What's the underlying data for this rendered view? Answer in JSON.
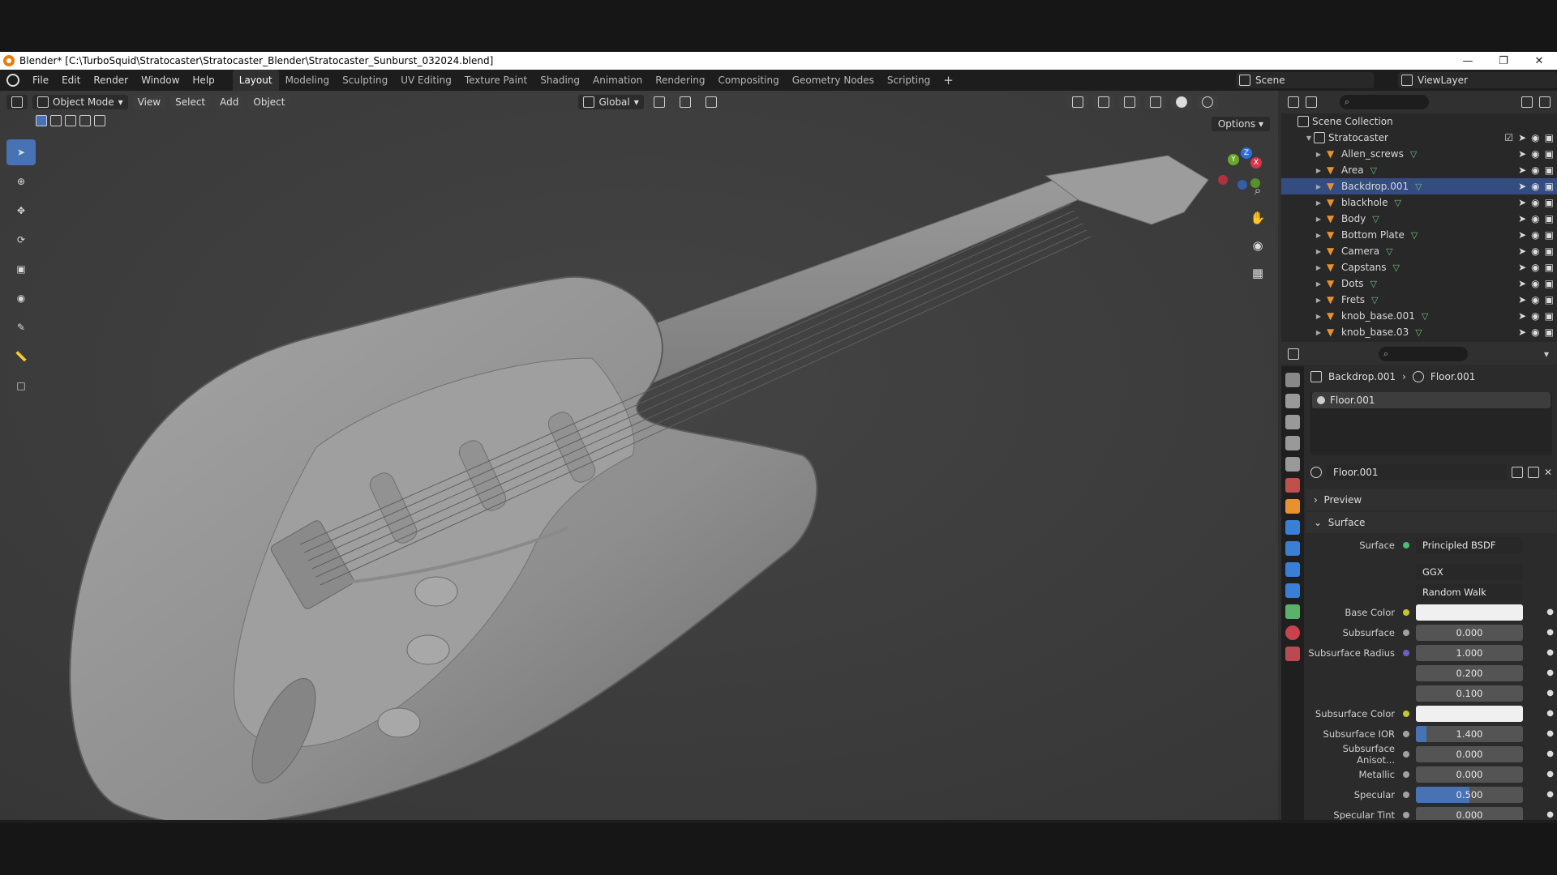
{
  "window": {
    "title": "Blender* [C:\\TurboSquid\\Stratocaster\\Stratocaster_Blender\\Stratocaster_Sunburst_032024.blend]"
  },
  "menu": {
    "items": [
      "File",
      "Edit",
      "Render",
      "Window",
      "Help"
    ]
  },
  "workspaces": {
    "tabs": [
      "Layout",
      "Modeling",
      "Sculpting",
      "UV Editing",
      "Texture Paint",
      "Shading",
      "Animation",
      "Rendering",
      "Compositing",
      "Geometry Nodes",
      "Scripting"
    ],
    "active": "Layout"
  },
  "scene": {
    "name": "Scene",
    "view_layer": "ViewLayer"
  },
  "viewport": {
    "mode": "Object Mode",
    "menus": [
      "View",
      "Select",
      "Add",
      "Object"
    ],
    "orientation": "Global",
    "options_label": "Options",
    "gizmo": {
      "x": "X",
      "y": "Y",
      "z": "Z"
    }
  },
  "outliner": {
    "collection": "Scene Collection",
    "root": "Stratocaster",
    "items": [
      {
        "name": "Allen_screws"
      },
      {
        "name": "Area"
      },
      {
        "name": "Backdrop.001"
      },
      {
        "name": "blackhole"
      },
      {
        "name": "Body"
      },
      {
        "name": "Bottom Plate"
      },
      {
        "name": "Camera"
      },
      {
        "name": "Capstans"
      },
      {
        "name": "Dots"
      },
      {
        "name": "Frets"
      },
      {
        "name": "knob_base.001"
      },
      {
        "name": "knob_base.03"
      }
    ],
    "selected": "Backdrop.001"
  },
  "properties": {
    "breadcrumb": {
      "object": "Backdrop.001",
      "material": "Floor.001"
    },
    "slot": "Floor.001",
    "material": "Floor.001",
    "panels": {
      "preview": "Preview",
      "surface": "Surface"
    },
    "surface_shader": "Principled BSDF",
    "distribution": "GGX",
    "subsurface_method": "Random Walk",
    "fields": [
      {
        "label": "Base Color",
        "type": "color",
        "value": ""
      },
      {
        "label": "Subsurface",
        "type": "num",
        "value": "0.000",
        "fill": 0
      },
      {
        "label": "Subsurface Radius",
        "type": "num",
        "value": "1.000",
        "fill": 0
      },
      {
        "label": "",
        "type": "num",
        "value": "0.200",
        "fill": 0
      },
      {
        "label": "",
        "type": "num",
        "value": "0.100",
        "fill": 0
      },
      {
        "label": "Subsurface Color",
        "type": "color",
        "value": ""
      },
      {
        "label": "Subsurface IOR",
        "type": "num",
        "value": "1.400",
        "fill": 0.1
      },
      {
        "label": "Subsurface Anisot...",
        "type": "num",
        "value": "0.000",
        "fill": 0
      },
      {
        "label": "Metallic",
        "type": "num",
        "value": "0.000",
        "fill": 0
      },
      {
        "label": "Specular",
        "type": "num",
        "value": "0.500",
        "fill": 0.5
      },
      {
        "label": "Specular Tint",
        "type": "num",
        "value": "0.000",
        "fill": 0
      }
    ]
  },
  "colors": {
    "accent": "#4772b3",
    "selected_row": "#334d80",
    "viewport_bg": "#3d3d3d"
  }
}
